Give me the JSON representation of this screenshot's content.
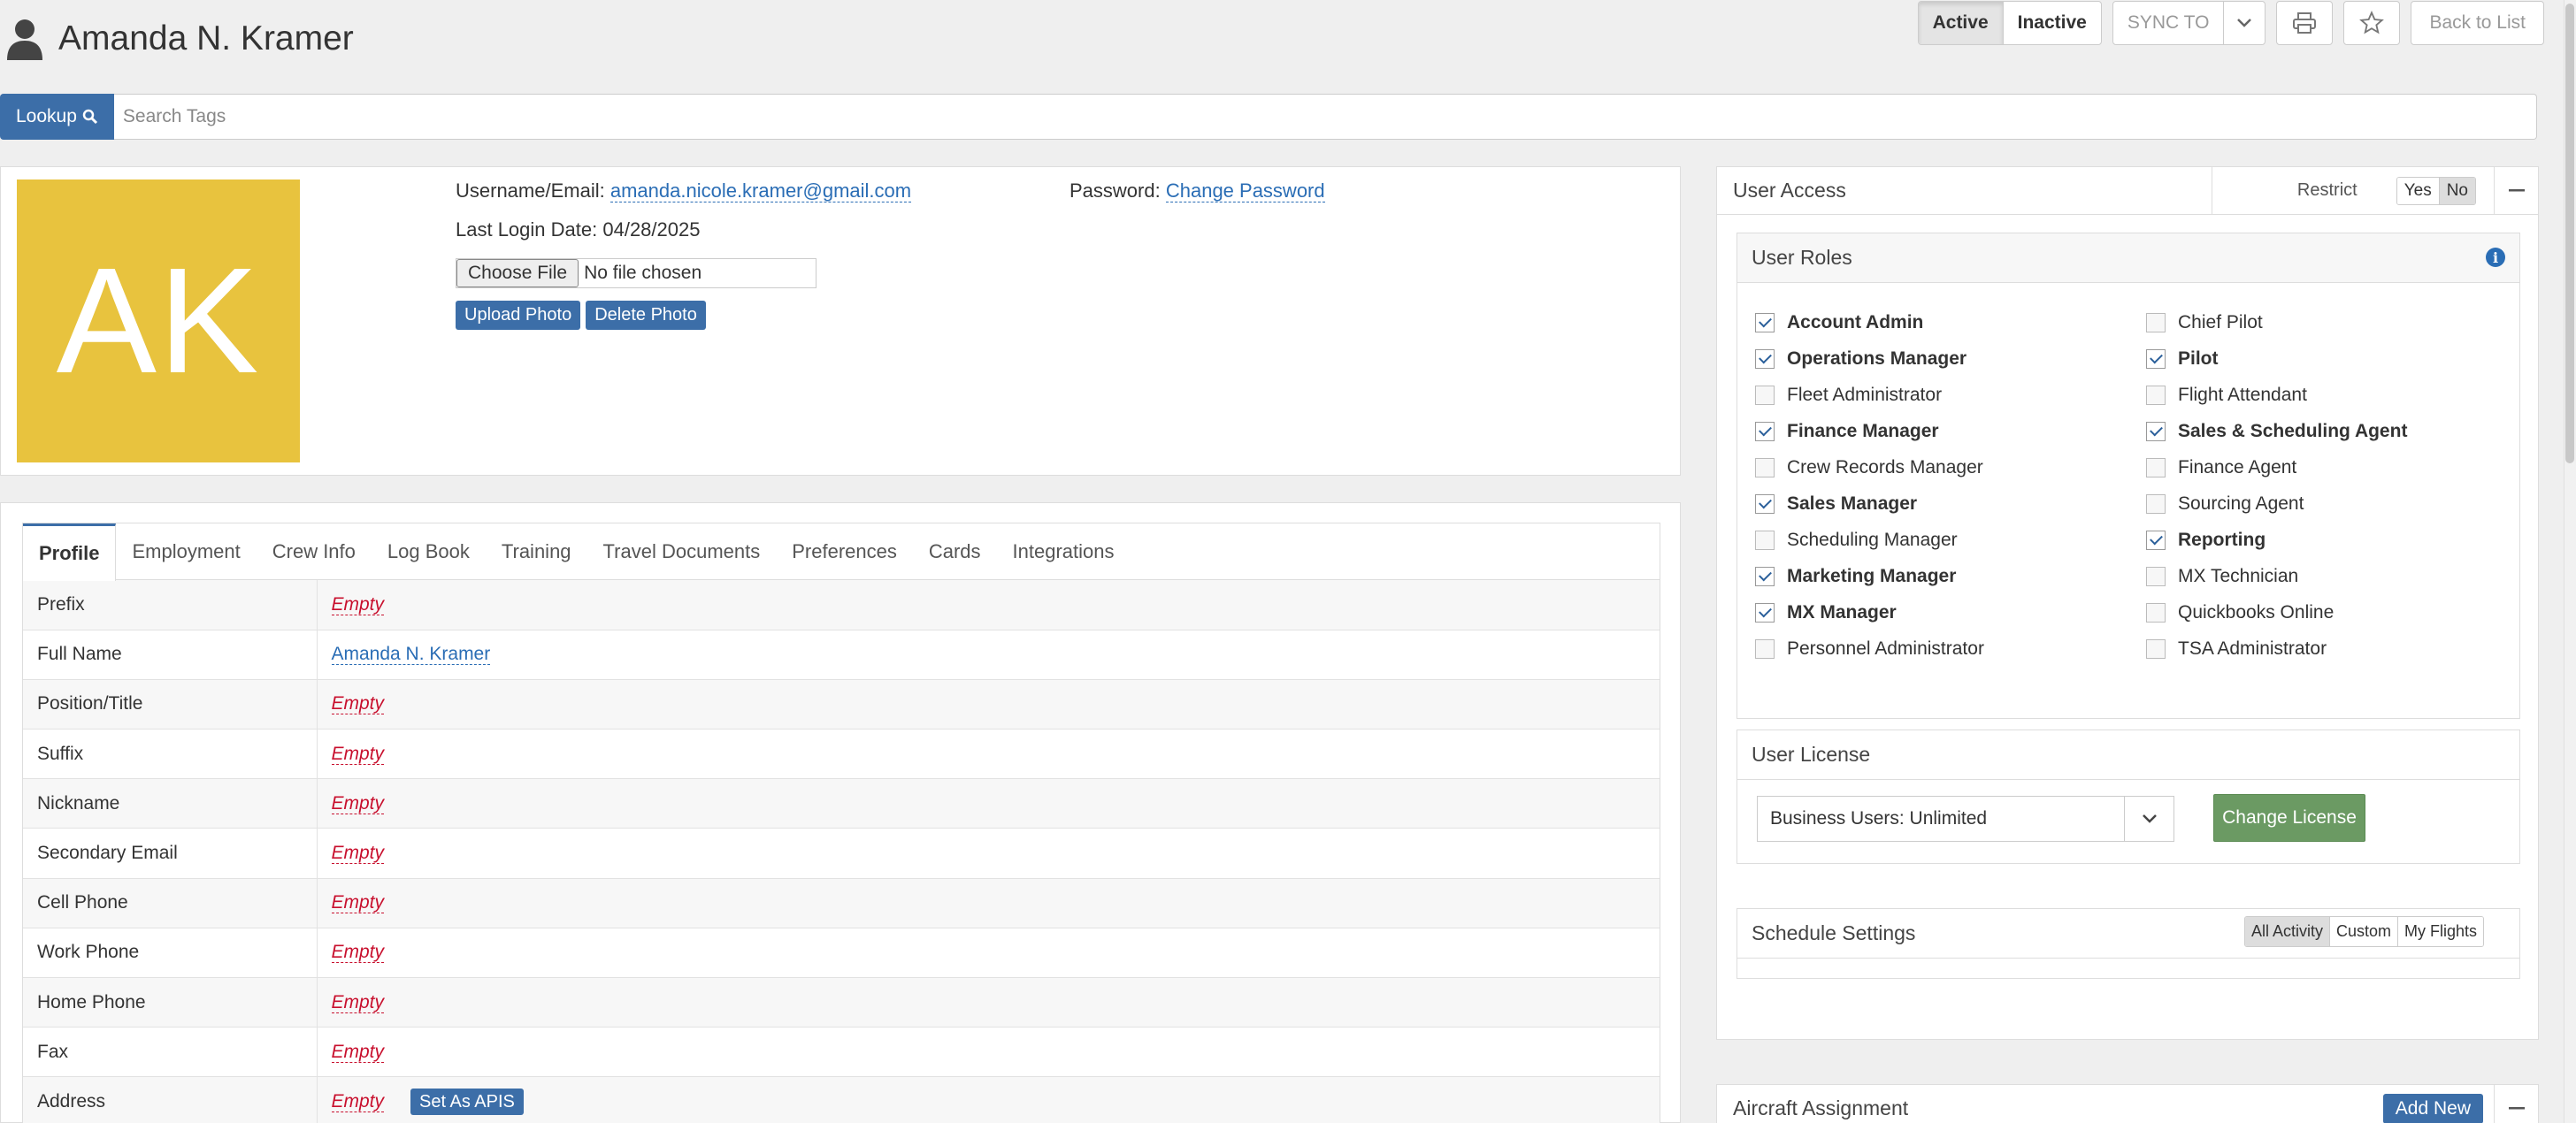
{
  "header": {
    "user_name": "Amanda N. Kramer",
    "status_active": "Active",
    "status_inactive": "Inactive",
    "sync_label": "SYNC TO",
    "back_label": "Back to List"
  },
  "search": {
    "lookup_label": "Lookup",
    "placeholder": "Search Tags"
  },
  "photo": {
    "initials": "AK",
    "avatar_color": "#e8c33e",
    "username_label": "Username/Email:",
    "username_value": "amanda.nicole.kramer@gmail.com",
    "password_label": "Password:",
    "password_link": "Change Password",
    "last_login_label": "Last Login Date:",
    "last_login_value": "04/28/2025",
    "choose_file": "Choose File",
    "no_file": "No file chosen",
    "upload_label": "Upload Photo",
    "delete_label": "Delete Photo"
  },
  "tabs": [
    "Profile",
    "Employment",
    "Crew Info",
    "Log Book",
    "Training",
    "Travel Documents",
    "Preferences",
    "Cards",
    "Integrations"
  ],
  "profile_rows": [
    {
      "label": "Prefix",
      "value": "Empty",
      "empty": true
    },
    {
      "label": "Full Name",
      "value": "Amanda N. Kramer",
      "empty": false
    },
    {
      "label": "Position/Title",
      "value": "Empty",
      "empty": true
    },
    {
      "label": "Suffix",
      "value": "Empty",
      "empty": true
    },
    {
      "label": "Nickname",
      "value": "Empty",
      "empty": true
    },
    {
      "label": "Secondary Email",
      "value": "Empty",
      "empty": true
    },
    {
      "label": "Cell Phone",
      "value": "Empty",
      "empty": true
    },
    {
      "label": "Work Phone",
      "value": "Empty",
      "empty": true
    },
    {
      "label": "Home Phone",
      "value": "Empty",
      "empty": true
    },
    {
      "label": "Fax",
      "value": "Empty",
      "empty": true
    },
    {
      "label": "Address",
      "value": "Empty",
      "empty": true
    }
  ],
  "set_apis_label": "Set As APIS",
  "user_access": {
    "title": "User Access",
    "restrict_label": "Restrict",
    "yes": "Yes",
    "no": "No"
  },
  "user_roles": {
    "title": "User Roles",
    "left": [
      {
        "label": "Account Admin",
        "checked": true
      },
      {
        "label": "Operations Manager",
        "checked": true
      },
      {
        "label": "Fleet Administrator",
        "checked": false
      },
      {
        "label": "Finance Manager",
        "checked": true
      },
      {
        "label": "Crew Records Manager",
        "checked": false
      },
      {
        "label": "Sales Manager",
        "checked": true
      },
      {
        "label": "Scheduling Manager",
        "checked": false
      },
      {
        "label": "Marketing Manager",
        "checked": true
      },
      {
        "label": "MX Manager",
        "checked": true
      },
      {
        "label": "Personnel Administrator",
        "checked": false
      }
    ],
    "right": [
      {
        "label": "Chief Pilot",
        "checked": false
      },
      {
        "label": "Pilot",
        "checked": true
      },
      {
        "label": "Flight Attendant",
        "checked": false
      },
      {
        "label": "Sales & Scheduling Agent",
        "checked": true
      },
      {
        "label": "Finance Agent",
        "checked": false
      },
      {
        "label": "Sourcing Agent",
        "checked": false
      },
      {
        "label": "Reporting",
        "checked": true
      },
      {
        "label": "MX Technician",
        "checked": false
      },
      {
        "label": "Quickbooks Online",
        "checked": false
      },
      {
        "label": "TSA Administrator",
        "checked": false
      }
    ]
  },
  "user_license": {
    "title": "User License",
    "selected": "Business Users: Unlimited",
    "change_label": "Change License"
  },
  "schedule": {
    "title": "Schedule Settings",
    "options": [
      "All Activity",
      "Custom",
      "My Flights"
    ]
  },
  "aircraft": {
    "title": "Aircraft Assignment",
    "add_label": "Add New"
  }
}
